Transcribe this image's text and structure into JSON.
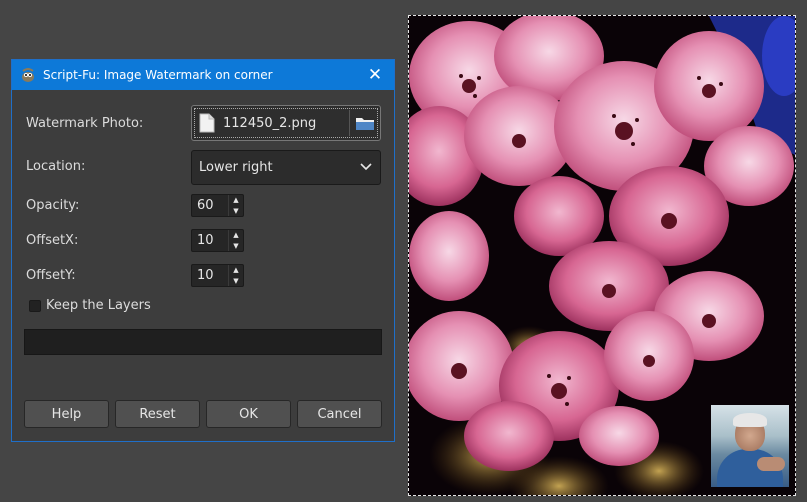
{
  "dialog": {
    "title": "Script-Fu: Image Watermark on corner",
    "close_glyph": "✕",
    "fields": {
      "watermark_photo": {
        "label": "Watermark Photo:",
        "value": "112450_2.png"
      },
      "location": {
        "label": "Location:",
        "value": "Lower right"
      },
      "opacity": {
        "label": "Opacity:",
        "value": "60"
      },
      "offset_x": {
        "label": "OffsetX:",
        "value": "10"
      },
      "offset_y": {
        "label": "OffsetY:",
        "value": "10"
      },
      "keep_layers": {
        "label": "Keep the Layers",
        "checked": false
      }
    },
    "buttons": {
      "help": "Help",
      "reset": "Reset",
      "ok": "OK",
      "cancel": "Cancel"
    }
  },
  "icons": {
    "app": "gimp-icon",
    "file": "file-icon",
    "folder": "folder-icon",
    "dropdown": "chevron-down-icon",
    "spin_up": "arrow-up-icon",
    "spin_down": "arrow-down-icon"
  },
  "colors": {
    "titlebar": "#0d79d8",
    "dialog_bg": "#3d3d3d",
    "workspace_bg": "#454545"
  }
}
